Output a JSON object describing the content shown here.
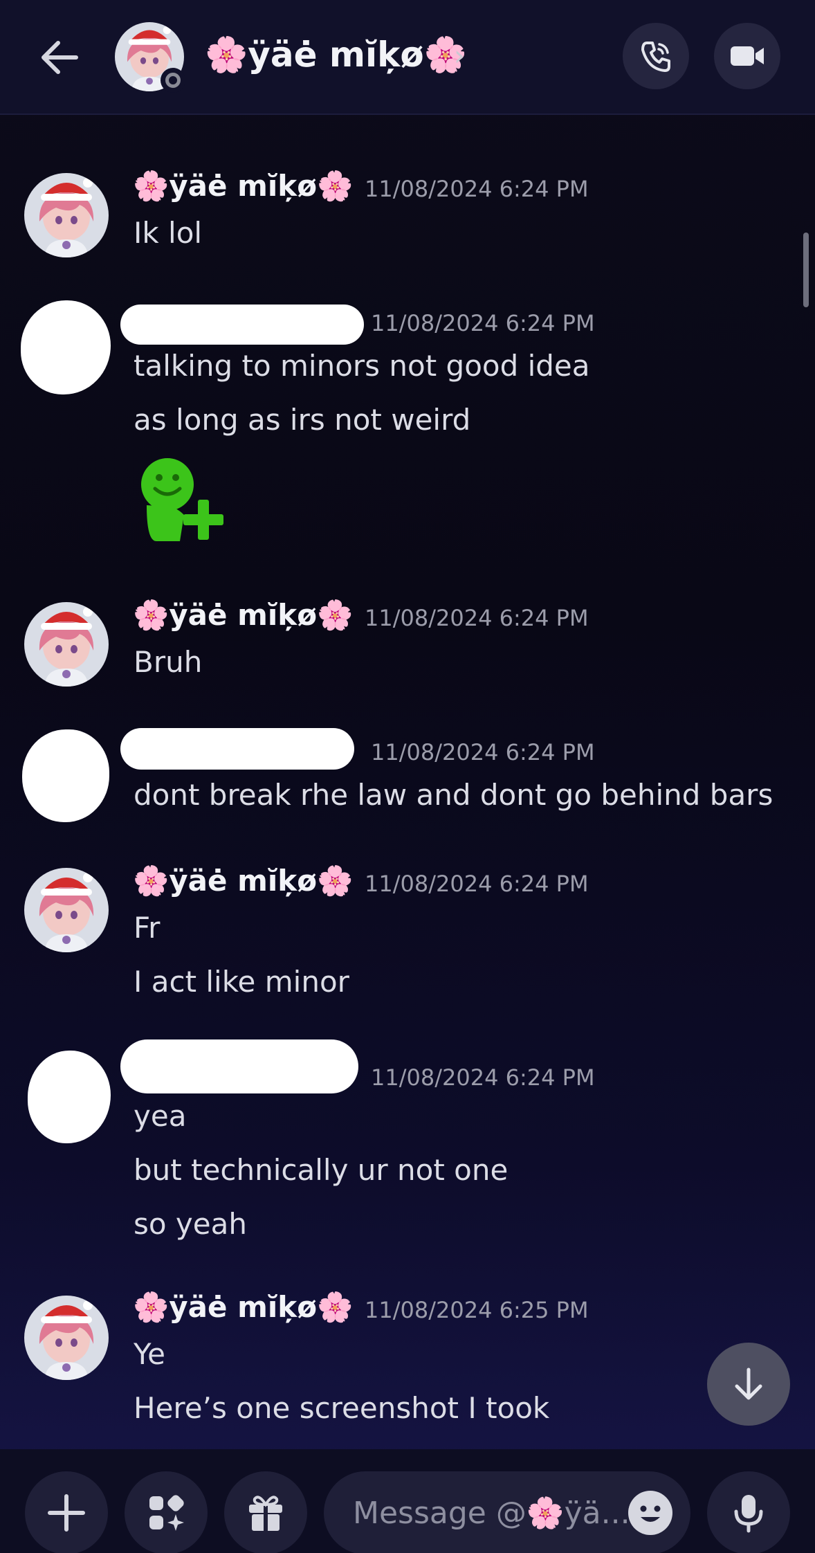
{
  "header": {
    "title": "🌸ÿäė mĭķø🌸",
    "chevron": "›",
    "icons": [
      "back-arrow-icon",
      "phone-call-icon",
      "video-camera-icon"
    ]
  },
  "messages": [
    {
      "author": "🌸ÿäė mĭķø🌸",
      "time": "11/08/2024 6:24 PM",
      "lines": [
        "Ik lol"
      ]
    },
    {
      "author": "",
      "time": "11/08/2024 6:24 PM",
      "lines": [
        "talking to minors not good idea",
        "as long as irs not weird"
      ],
      "sticker": "green-smiley-add-friend-icon"
    },
    {
      "author": "🌸ÿäė mĭķø🌸",
      "time": "11/08/2024 6:24 PM",
      "lines": [
        "Bruh"
      ]
    },
    {
      "author": "",
      "time": "11/08/2024 6:24 PM",
      "lines": [
        "dont break rhe law and dont go behind bars"
      ]
    },
    {
      "author": "🌸ÿäė mĭķø🌸",
      "time": "11/08/2024 6:24 PM",
      "lines": [
        "Fr",
        "I act like minor"
      ]
    },
    {
      "author": "",
      "time": "11/08/2024 6:24 PM",
      "lines": [
        "yea",
        "but technically ur not one",
        "so yeah"
      ]
    },
    {
      "author": "🌸ÿäė mĭķø🌸",
      "time": "11/08/2024 6:25 PM",
      "lines": [
        "Ye",
        "Here’s one screenshot I took"
      ]
    }
  ],
  "composer": {
    "placeholder": "Message @🌸ÿä...",
    "icons": [
      "plus-icon",
      "apps-icon",
      "gift-icon",
      "emoji-icon",
      "microphone-icon"
    ]
  },
  "colors": {
    "background": "#0a0918",
    "header": "#11112a",
    "text": "#dcdde6",
    "timestamp": "#9c9dab",
    "sticker_green": "#3cc41a"
  }
}
